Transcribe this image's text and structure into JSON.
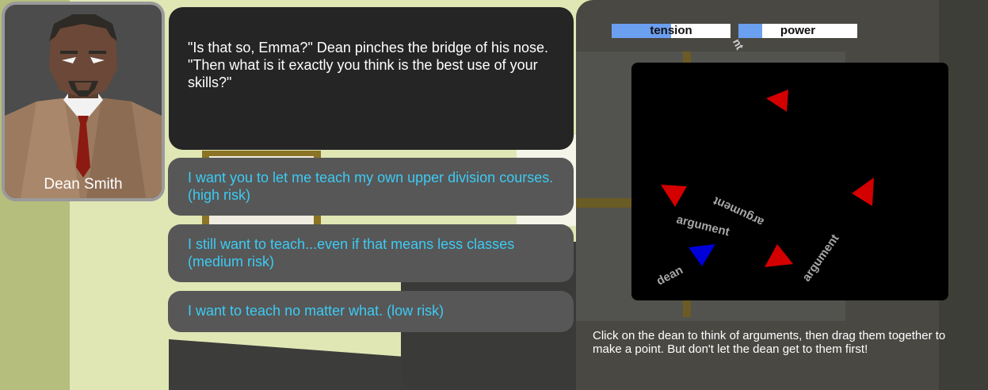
{
  "portrait": {
    "name": "Dean Smith"
  },
  "dialogue": {
    "text": "\"Is that so, Emma?\" Dean pinches the bridge of his nose. \"Then what is it exactly you think is the best use of your skills?\""
  },
  "choices": [
    {
      "label": "I want you to let me teach my own upper division courses. (high risk)"
    },
    {
      "label": "I still want to teach...even if that means less classes (medium risk)"
    },
    {
      "label": "I want to teach no matter what. (low risk)"
    }
  ],
  "meters": {
    "tension": {
      "label": "tension",
      "level": 0.5,
      "color": "#6b9ff0"
    },
    "power": {
      "label": "power",
      "level": 0.2,
      "color": "#6b9ff0"
    }
  },
  "stray_label": "nt",
  "arena": {
    "labels": {
      "argument_1": "argument",
      "argument_2": "argument",
      "argument_3": "argument",
      "dean": "dean"
    },
    "colors": {
      "argument": "#d40000",
      "dean": "#0000d8",
      "background": "#000000"
    }
  },
  "instructions": "Click on the dean to think of arguments, then drag them together to make a point. But don't let the dean get to them first!"
}
